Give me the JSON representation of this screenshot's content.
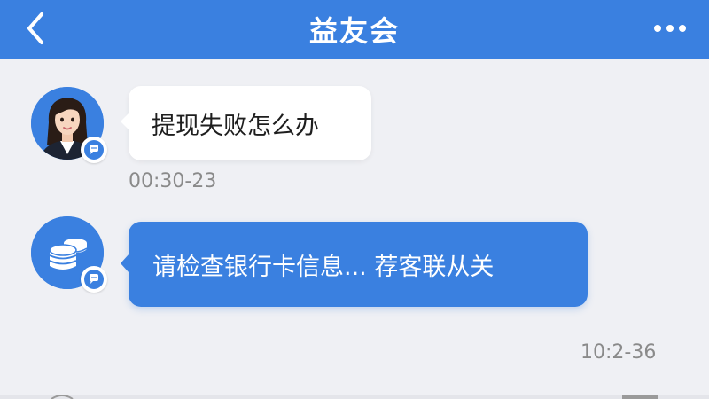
{
  "header": {
    "title": "益友会",
    "back_icon": "chevron-left-icon",
    "more_icon": "more-horizontal-icon",
    "background_color": "#3a80e0"
  },
  "messages": [
    {
      "direction": "incoming",
      "avatar": "woman-agent-avatar",
      "badge_icon": "chat-bubble-icon",
      "text": "提现失败怎么办",
      "timestamp": "00:30-23"
    },
    {
      "direction": "outgoing",
      "avatar": "coin-stack-icon",
      "badge_icon": "chat-bubble-icon",
      "text": "请检查银行卡信息... 荐客联从关",
      "timestamp": "10:2-36"
    }
  ],
  "colors": {
    "accent": "#3a80e0",
    "background": "#eff0f4",
    "incoming_bubble": "#ffffff",
    "timestamp": "#8a8a8a"
  }
}
